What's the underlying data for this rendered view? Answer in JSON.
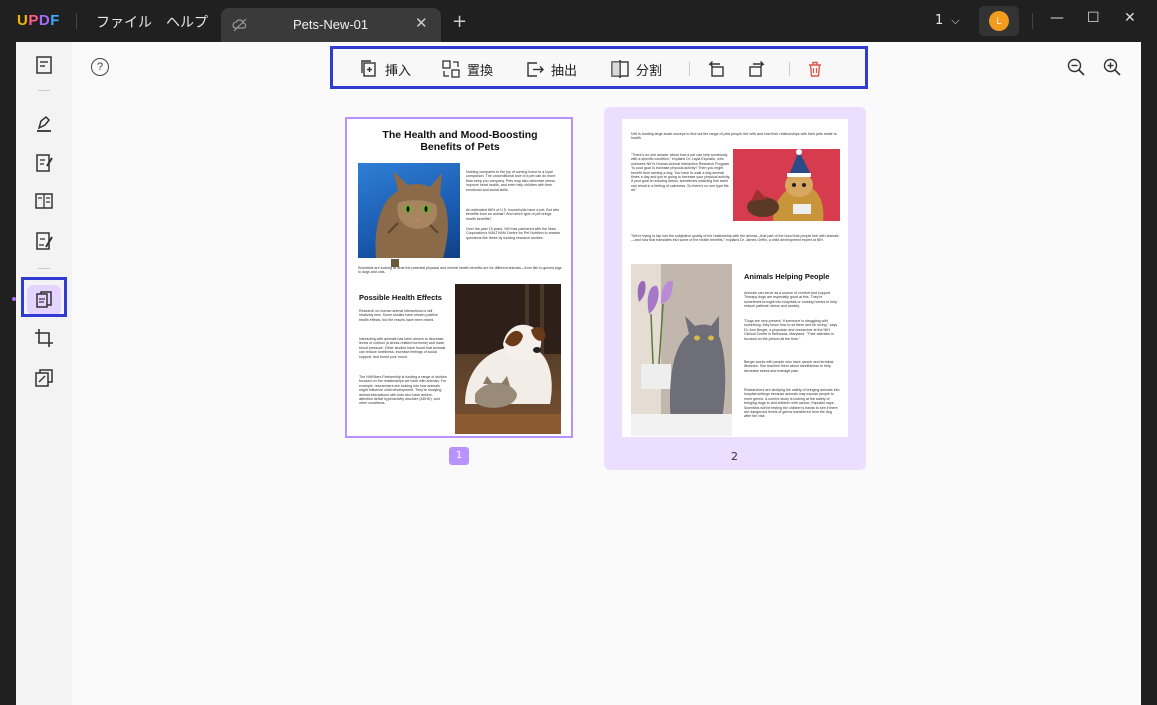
{
  "app": {
    "logo": "UPDF",
    "menu": [
      "ファイル",
      "ヘルプ"
    ],
    "tab_title": "Pets-New-01",
    "page_selector": "1",
    "avatar_initial": "L",
    "accent": "#a56bff"
  },
  "toolbar": {
    "insert_label": "挿入",
    "replace_label": "置換",
    "extract_label": "抽出",
    "split_label": "分割",
    "help_label": "?"
  },
  "pages": {
    "page1_number": "1",
    "page2_number": "2"
  },
  "doc1": {
    "title": "The Health and Mood-Boosting Benefits of Pets",
    "col_text_1": "Nothing compares to the joy of coming home to a loyal companion. The unconditional love of a pet can do more than keep you company. Pets may also decrease stress, improve heart health, and even help children with their emotional and social skills.",
    "col_text_2": "An estimated 68% of U.S. households have a pet. But who benefits from an animal? And which type of pet brings health benefits?",
    "col_text_3": "Over the past 15 years, NIH has partnered with the Mars Corporation's WALTHAM Centre for Pet Nutrition to answer questions like these by funding research studies.",
    "caption": "Scientists are looking at what the potential physical and mental health benefits are for different animals—from fish to guinea pigs to dogs and cats.",
    "h2": "Possible Health Effects",
    "effects_1": "Research on human-animal interactions is still relatively new. Some studies have shown positive health effects, but the results have been mixed.",
    "effects_2": "Interacting with animals has been shown to decrease levels of cortisol (a stress-related hormone) and lower blood pressure. Other studies have found that animals can reduce loneliness, increase feelings of social support, and boost your mood.",
    "effects_3": "The NIH/Mars Partnership is funding a range of studies focused on the relationships we have with animals. For example, researchers are looking into how animals might influence child development. They're studying animal interactions with kids who have autism, attention deficit hyperactivity disorder (ADHD), and other conditions."
  },
  "doc2": {
    "intro": "NIH is funding large-scale surveys to find out the range of pets people live with and how their relationships with their pets relate to health.",
    "quote_1": "\"There's no one answer about how a pet can help somebody with a specific condition,\" explains Dr. Layla Esposito, who oversees NIH's Human-Animal Interaction Research Program. \"Is your goal to increase physical activity? Then you might benefit from owning a dog. You have to walk a dog several times a day and you're going to increase your physical activity. If your goal is reducing stress, sometimes watching fish swim can result in a feeling of calmness. So there's no one type fits all.\"",
    "quote_2": "\"We're trying to tap into the subjective quality of the relationship with the animal—that part of the bond that people feel with animals—and how that translates into some of the health benefits,\" explains Dr. James Griffin, a child development expert at NIH.",
    "h2": "Animals Helping People",
    "helping_1": "Animals can serve as a source of comfort and support. Therapy dogs are especially good at this. They're sometimes brought into hospitals or nursing homes to help reduce patients' stress and anxiety.",
    "helping_2": "\"Dogs are very present. If someone is struggling with something, they know how to sit there and be loving,\" says Dr. Ann Berger, a physician and researcher at the NIH Clinical Center in Bethesda, Maryland. \"Their attention is focused on the person all the time.\"",
    "helping_3": "Berger works with people who have cancer and terminal illnesses. She teaches them about mindfulness to help decrease stress and manage pain.",
    "helping_4": "Researchers are studying the safety of bringing animals into hospital settings because animals may expose people to more germs. A current study is looking at the safety of bringing dogs to visit children with cancer, Esposito says. Scientists will be testing the children's hands to see if there are dangerous levels of germs transferred from the dog after the visit."
  }
}
